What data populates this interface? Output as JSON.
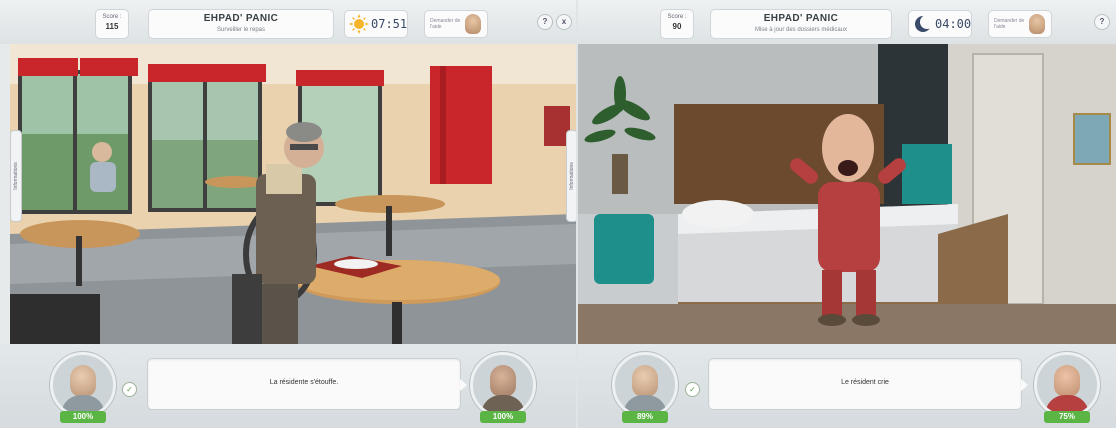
{
  "left": {
    "score_label": "Score :",
    "score_value": "115",
    "game_title": "EHPAD' PANIC",
    "mission": "Surveiller le repas",
    "clock_icon": "sun-icon",
    "time": "07:51",
    "ask_text": "Demander de l'aide",
    "help_label": "?",
    "close_label": "x",
    "side_tab": "Informations",
    "scene_name": "dining-room",
    "caregiver_progress": "100%",
    "message": "La résidente s'étouffe.",
    "resident_progress": "100%"
  },
  "right": {
    "score_label": "Score :",
    "score_value": "90",
    "game_title": "EHPAD' PANIC",
    "mission": "Mise à jour des dossiers médicaux",
    "clock_icon": "moon-icon",
    "time": "04:00",
    "ask_text": "Demander de l'aide",
    "help_label": "?",
    "side_tab": "Informations",
    "scene_name": "bedroom",
    "caregiver_progress": "89%",
    "message": "Le résident crie",
    "resident_progress": "75%"
  },
  "colors": {
    "progress_green": "#5bb545",
    "accent_red": "#c9262b",
    "clock_sun": "#f4b52a",
    "clock_moon": "#3a4a6a"
  }
}
